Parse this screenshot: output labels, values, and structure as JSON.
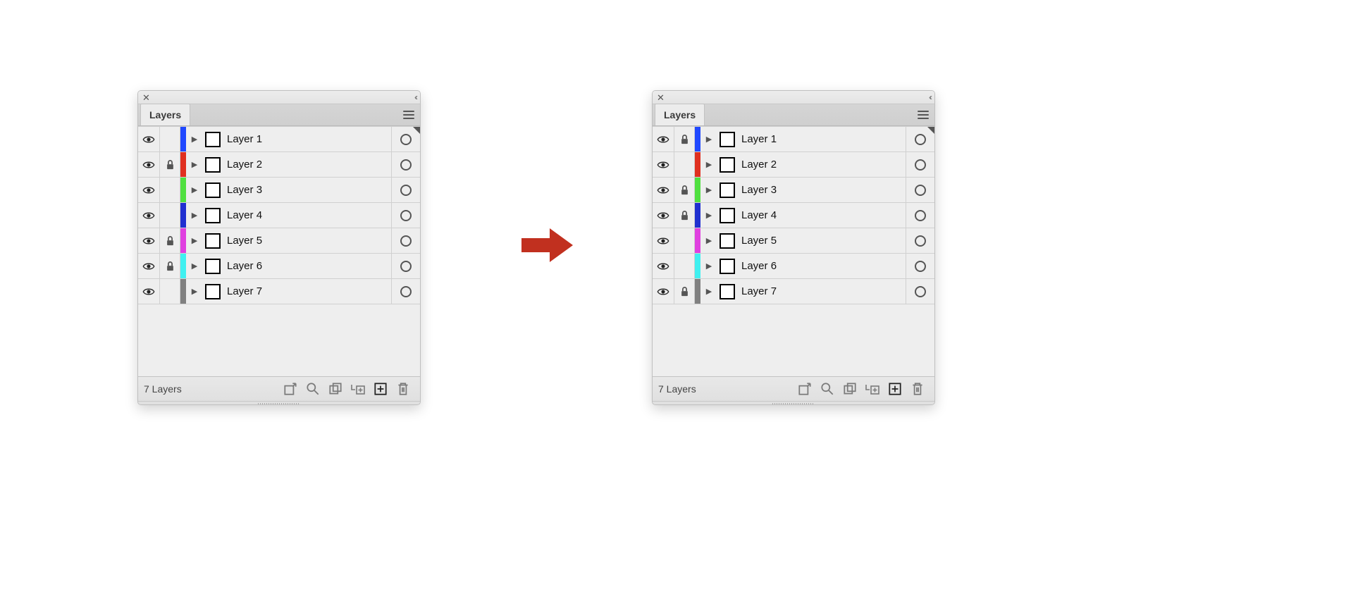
{
  "panels": [
    {
      "tab_label": "Layers",
      "footer_count": "7 Layers",
      "layers": [
        {
          "name": "Layer 1",
          "color": "#2048ff",
          "locked": false
        },
        {
          "name": "Layer 2",
          "color": "#e03020",
          "locked": true
        },
        {
          "name": "Layer 3",
          "color": "#50e040",
          "locked": false
        },
        {
          "name": "Layer 4",
          "color": "#2030d0",
          "locked": false
        },
        {
          "name": "Layer 5",
          "color": "#e040e0",
          "locked": true
        },
        {
          "name": "Layer 6",
          "color": "#40f0f0",
          "locked": true
        },
        {
          "name": "Layer 7",
          "color": "#808080",
          "locked": false
        }
      ]
    },
    {
      "tab_label": "Layers",
      "footer_count": "7 Layers",
      "layers": [
        {
          "name": "Layer 1",
          "color": "#2048ff",
          "locked": true
        },
        {
          "name": "Layer 2",
          "color": "#e03020",
          "locked": false
        },
        {
          "name": "Layer 3",
          "color": "#50e040",
          "locked": true
        },
        {
          "name": "Layer 4",
          "color": "#2030d0",
          "locked": true
        },
        {
          "name": "Layer 5",
          "color": "#e040e0",
          "locked": false
        },
        {
          "name": "Layer 6",
          "color": "#40f0f0",
          "locked": false
        },
        {
          "name": "Layer 7",
          "color": "#808080",
          "locked": true
        }
      ]
    }
  ],
  "arrow_color": "#c1301f"
}
